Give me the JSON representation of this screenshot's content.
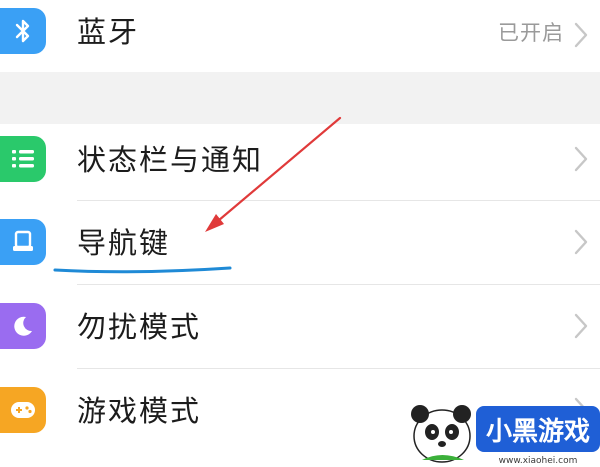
{
  "settings": {
    "bluetooth": {
      "label": "蓝牙",
      "value": "已开启",
      "icon": "bluetooth-icon",
      "color": "#3aa0f5"
    },
    "status_bar": {
      "label": "状态栏与通知",
      "icon": "list-icon",
      "color": "#2ac96b"
    },
    "nav_keys": {
      "label": "导航键",
      "icon": "navigation-keys-icon",
      "color": "#3aa0f5"
    },
    "dnd": {
      "label": "勿扰模式",
      "icon": "moon-icon",
      "color": "#9a6cf0"
    },
    "game_mode": {
      "label": "游戏模式",
      "icon": "gamepad-icon",
      "color": "#f6a623"
    }
  },
  "annotations": {
    "arrow_color": "#e03a3a",
    "underline_color": "#1f8ad6"
  },
  "watermark": {
    "brand": "小黑游戏",
    "url": "www.xiaohei.com"
  }
}
